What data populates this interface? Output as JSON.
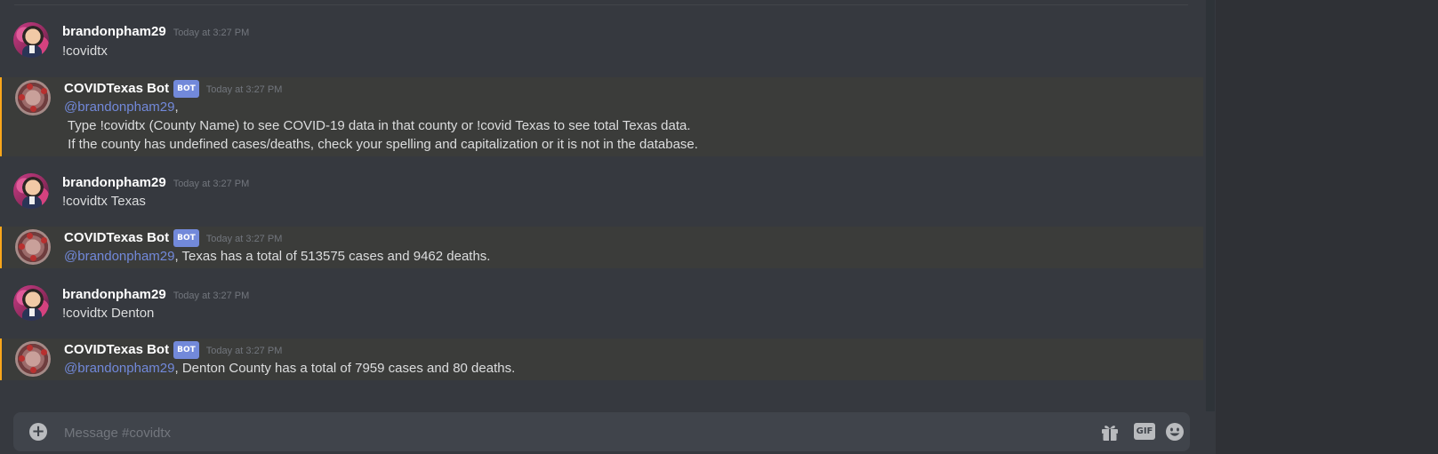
{
  "channel": {
    "input_placeholder": "Message #covidtx"
  },
  "messages": [
    {
      "author": "brandonpham29",
      "time": "Today at 3:27 PM",
      "lines": [
        "!covidtx"
      ]
    },
    {
      "author": "COVIDTexas Bot",
      "badge": "BOT",
      "time": "Today at 3:27 PM",
      "mention": "@brandonpham29",
      "after_mention": ",",
      "lines": [
        " Type !covidtx (County Name) to see COVID-19 data in that county or !covid Texas to see total Texas data.",
        " If the county has undefined cases/deaths, check your spelling and capitalization or it is not in the database."
      ]
    },
    {
      "author": "brandonpham29",
      "time": "Today at 3:27 PM",
      "lines": [
        "!covidtx Texas"
      ]
    },
    {
      "author": "COVIDTexas Bot",
      "badge": "BOT",
      "time": "Today at 3:27 PM",
      "mention": "@brandonpham29",
      "after_mention": ", Texas has a total of 513575 cases and 9462 deaths."
    },
    {
      "author": "brandonpham29",
      "time": "Today at 3:27 PM",
      "lines": [
        "!covidtx Denton"
      ]
    },
    {
      "author": "COVIDTexas Bot",
      "badge": "BOT",
      "time": "Today at 3:27 PM",
      "mention": "@brandonpham29",
      "after_mention": ", Denton County has a total of 7959 cases and 80 deaths."
    }
  ],
  "input_buttons": {
    "gif_label": "GIF"
  },
  "colors": {
    "mention": "#7289da",
    "highlight_border": "#faa61a",
    "background": "#36393f"
  },
  "icons": [
    "plus-circle-icon",
    "gift-icon",
    "gif-icon",
    "emoji-icon"
  ]
}
